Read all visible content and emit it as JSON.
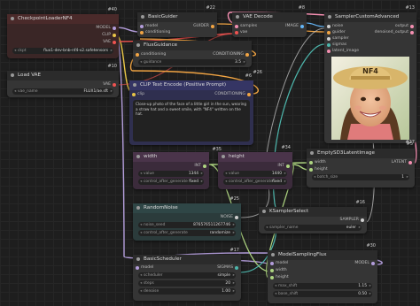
{
  "nodes": {
    "checkpoint": {
      "id": "#40",
      "title": "CheckpointLoaderNF4",
      "outputs": [
        "MODEL",
        "CLIP",
        "VAE"
      ],
      "widget_key": "ckpt",
      "widget_value": "flux1-dev-bnb-nf4-v2.safetensors"
    },
    "loadvae": {
      "id": "#10",
      "title": "Load VAE",
      "output": "VAE",
      "widget_key": "vae_name",
      "widget_value": "FLUX1/ae.sft"
    },
    "basicguider": {
      "id": "#22",
      "title": "BasicGuider",
      "inputs": [
        "model",
        "conditioning"
      ],
      "output": "GUIDER"
    },
    "vaedecode": {
      "id": "#8",
      "title": "VAE Decode",
      "inputs": [
        "samples",
        "vae"
      ],
      "output": "IMAGE"
    },
    "sampler": {
      "id": "#13",
      "title": "SamplerCustomAdvanced",
      "inputs": [
        "noise",
        "guider",
        "sampler",
        "sigmas",
        "latent_image"
      ],
      "outputs": [
        "output",
        "denoised_output"
      ]
    },
    "fluxguidance": {
      "id": "#26",
      "title": "FluxGuidance",
      "input": "conditioning",
      "output": "CONDITIONING",
      "widget_key": "guidance",
      "widget_value": "3.5"
    },
    "clipencode": {
      "id": "#6",
      "title": "CLIP Text Encode (Positive Prompt)",
      "input": "clip",
      "output": "CONDITIONING",
      "text": "Close-up photo of the face of a little girl in the sun, wearing a straw hat and a sweet smile, with \"NF4\" written on the hat."
    },
    "image": {
      "id": "#27",
      "hat_text": "NF4"
    },
    "width": {
      "id": "#35",
      "title": "width",
      "output": "INT",
      "widgets": [
        {
          "k": "value",
          "v": "1344"
        },
        {
          "k": "control_after_generate",
          "v": "fixed"
        }
      ]
    },
    "height": {
      "id": "#34",
      "title": "height",
      "output": "INT",
      "widgets": [
        {
          "k": "value",
          "v": "1440"
        },
        {
          "k": "control_after_generate",
          "v": "fixed"
        }
      ]
    },
    "emptylatent": {
      "id": "#5",
      "title": "EmptySD3LatentImage",
      "inputs": [
        "width",
        "height"
      ],
      "output": "LATENT",
      "widget_key": "batch_size",
      "widget_value": "1"
    },
    "randomnoise": {
      "id": "#25",
      "title": "RandomNoise",
      "output": "NOISE",
      "widgets": [
        {
          "k": "noise_seed",
          "v": "876576511267746"
        },
        {
          "k": "control_after_generate",
          "v": "randomize"
        }
      ]
    },
    "ksamplerselect": {
      "id": "#16",
      "title": "KSamplerSelect",
      "output": "SAMPLER",
      "widget_key": "sampler_name",
      "widget_value": "euler"
    },
    "basicscheduler": {
      "id": "#17",
      "title": "BasicScheduler",
      "input": "model",
      "output": "SIGMAS",
      "widgets": [
        {
          "k": "scheduler",
          "v": "simple"
        },
        {
          "k": "steps",
          "v": "20"
        },
        {
          "k": "denoise",
          "v": "1.00"
        }
      ]
    },
    "modelsampling": {
      "id": "#30",
      "title": "ModelSamplingFlux",
      "inputs": [
        "model",
        "width",
        "height"
      ],
      "output": "MODEL",
      "widgets": [
        {
          "k": "max_shift",
          "v": "1.15"
        },
        {
          "k": "base_shift",
          "v": "0.50"
        }
      ]
    }
  },
  "colors": {
    "canvas": "#1e1e1e",
    "node": "#353535",
    "clip_node": "#2f2f4f",
    "int_node": "#3b2b3b",
    "noise_node": "#2b3b3b",
    "model_wire": "#b39ddb",
    "clip_wire": "#e8c547",
    "vae_wire": "#ef5350",
    "cond_wire": "#f1a443",
    "latent_wire": "#f48fb1",
    "int_wire": "#aed581",
    "image_wire": "#64b5f6"
  }
}
